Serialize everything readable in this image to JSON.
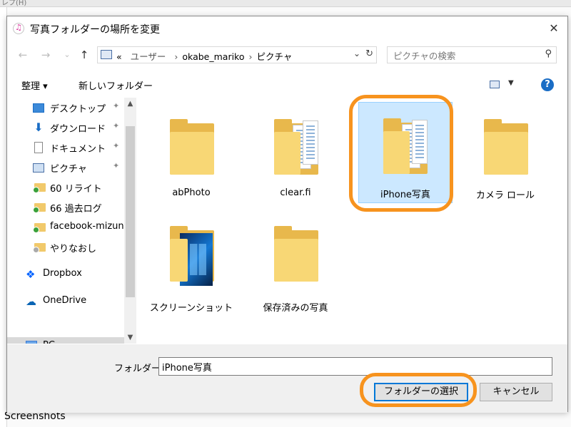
{
  "background": {
    "topbar_text": "レプ(H)",
    "bottom_text": "Screenshots"
  },
  "dialog": {
    "title": "写真フォルダーの場所を変更",
    "close_glyph": "✕"
  },
  "nav": {
    "back_glyph": "←",
    "forward_glyph": "→",
    "history_glyph": "⌄",
    "up_glyph": "↑",
    "breadcrumbs": {
      "prefix": "«",
      "items": [
        "ユーザー",
        "okabe_mariko",
        "ピクチャ"
      ],
      "sep": "›"
    },
    "dropdown_glyph": "⌄",
    "refresh_glyph": "↻",
    "search_placeholder": "ピクチャの検索",
    "search_glyph": "⚲"
  },
  "toolbar": {
    "organize": "整理 ▾",
    "new_folder": "新しいフォルダー",
    "view_dropdown": "▼",
    "help": "?"
  },
  "sidebar": {
    "items": [
      {
        "label": "デスクトップ",
        "icon": "desktop-icon",
        "pinned": true
      },
      {
        "label": "ダウンロード",
        "icon": "download-icon",
        "pinned": true
      },
      {
        "label": "ドキュメント",
        "icon": "document-icon",
        "pinned": true
      },
      {
        "label": "ピクチャ",
        "icon": "pictures-icon",
        "pinned": true
      },
      {
        "label": "60 リライト",
        "icon": "folder-icon"
      },
      {
        "label": "66 過去ログ",
        "icon": "folder-icon"
      },
      {
        "label": "facebook-mizun",
        "icon": "folder-icon"
      },
      {
        "label": "やりなおし",
        "icon": "folder-icon"
      },
      {
        "label": "Dropbox",
        "icon": "dropbox-icon"
      },
      {
        "label": "OneDrive",
        "icon": "onedrive-icon"
      },
      {
        "label": "PC",
        "icon": "pc-icon",
        "selected": true
      }
    ],
    "pin_glyph": "📌",
    "scroll_up": "▲",
    "scroll_down": "▼"
  },
  "files": [
    {
      "name": "abPhoto",
      "type": "folder"
    },
    {
      "name": "clear.fi",
      "type": "folder-docs"
    },
    {
      "name": "iPhone写真",
      "type": "folder-docs",
      "selected": true
    },
    {
      "name": "カメラ ロール",
      "type": "folder"
    },
    {
      "name": "スクリーンショット",
      "type": "folder-image"
    },
    {
      "name": "保存済みの写真",
      "type": "folder"
    }
  ],
  "footer": {
    "folder_label": "フォルダー:",
    "folder_value": "iPhone写真",
    "select_button": "フォルダーの選択",
    "cancel_button": "キャンセル"
  },
  "colors": {
    "highlight": "#f7931e",
    "selection": "#cce8ff",
    "accent": "#0078d7"
  }
}
